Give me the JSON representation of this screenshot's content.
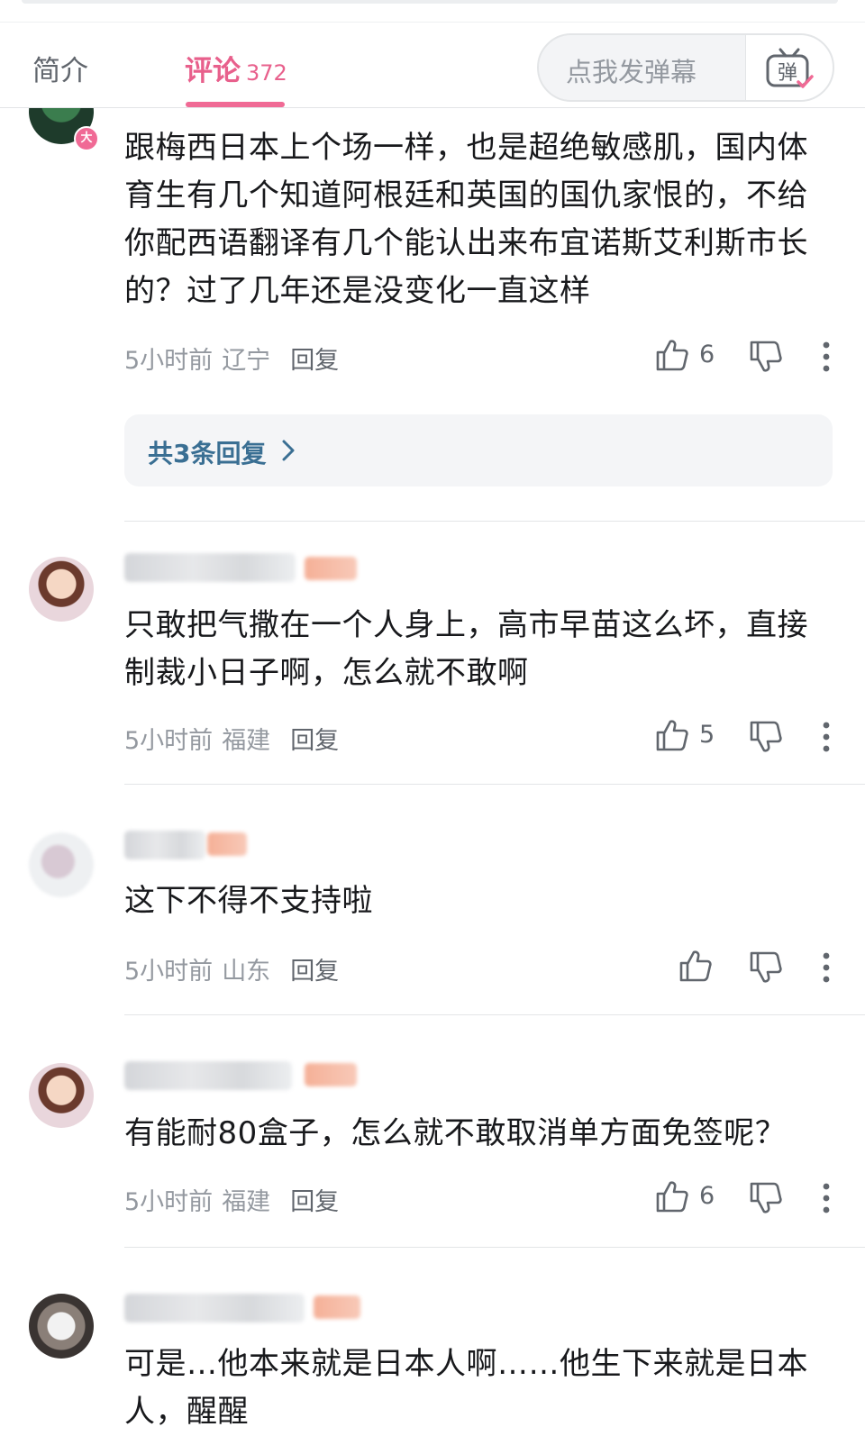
{
  "tabs": {
    "intro": "简介",
    "comments": "评论",
    "comment_count": "372"
  },
  "danmaku": {
    "placeholder": "点我发弹幕",
    "icon_char": "弹"
  },
  "comments": [
    {
      "text": "跟梅西日本上个场一样，也是超绝敏感肌，国内体育生有几个知道阿根廷和英国的国仇家恨的，不给你配西语翻译有几个能认出来布宜诺斯艾利斯市长的？过了几年还是没变化一直这样",
      "time": "5小时前",
      "location": "辽宁",
      "reply": "回复",
      "likes": "6",
      "badge": "大",
      "replies_label": "共3条回复"
    },
    {
      "text": "只敢把气撒在一个人身上，高市早苗这么坏，直接制裁小日子啊，怎么就不敢啊",
      "time": "5小时前",
      "location": "福建",
      "reply": "回复",
      "likes": "5"
    },
    {
      "text": "这下不得不支持啦",
      "time": "5小时前",
      "location": "山东",
      "reply": "回复",
      "likes": ""
    },
    {
      "text": "有能耐80盒子，怎么就不敢取消单方面免签呢？",
      "time": "5小时前",
      "location": "福建",
      "reply": "回复",
      "likes": "6"
    },
    {
      "text": "可是…他本来就是日本人啊……他生下来就是日本人，醒醒"
    }
  ],
  "colors": {
    "accent": "#e8608c",
    "link": "#3a6f93",
    "muted": "#9499a0"
  },
  "icons": [
    "danmaku-icon",
    "thumb-up-icon",
    "thumb-down-icon",
    "more-vertical-icon",
    "chevron-right-icon"
  ]
}
